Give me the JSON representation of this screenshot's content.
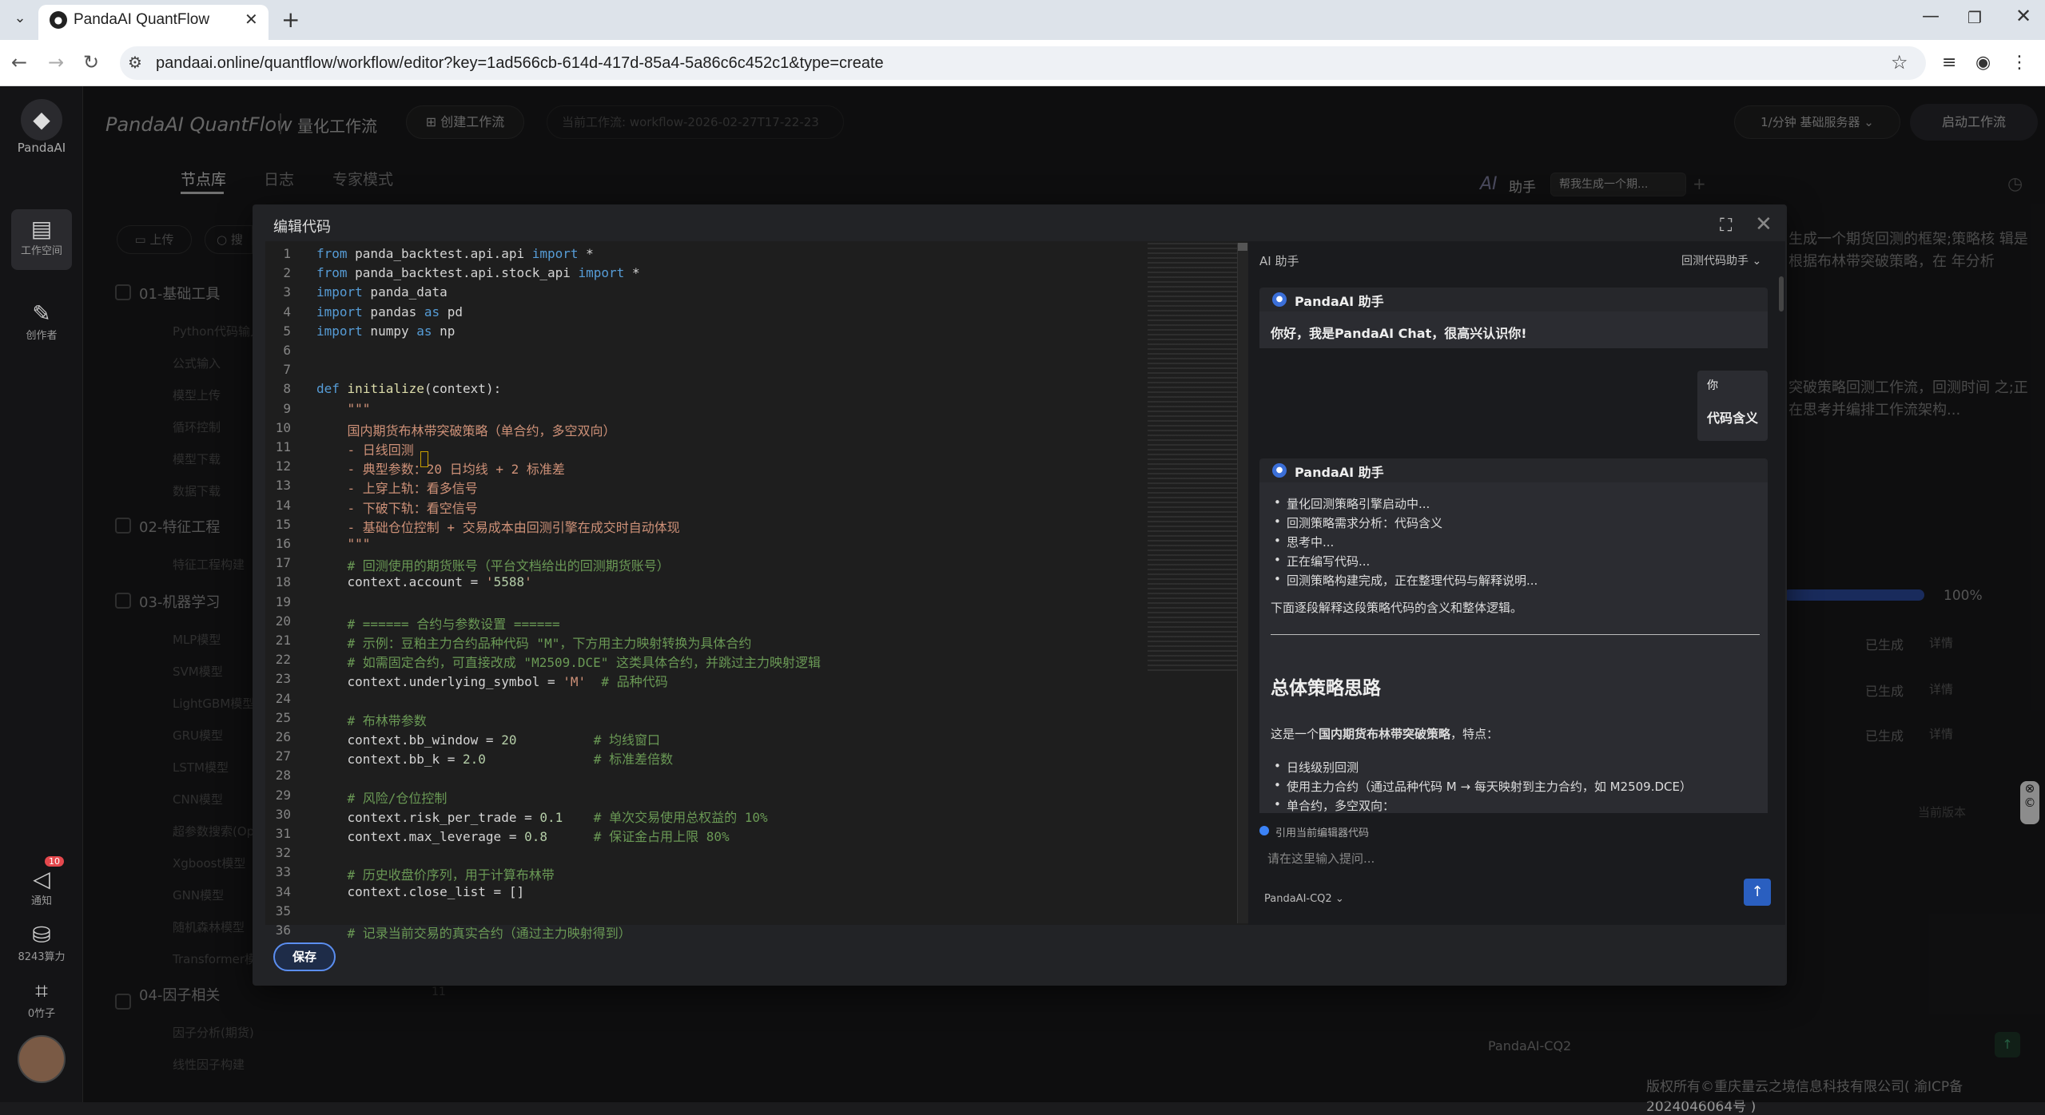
{
  "browser": {
    "tab_title": "PandaAI QuantFlow",
    "url": "pandaai.online/quantflow/workflow/editor?key=1ad566cb-614d-417d-85a4-5a86c6c452c1&type=create"
  },
  "sidebar": {
    "logo_text": "PandaAI",
    "items": [
      {
        "label": "工作空间",
        "icon": "layers-icon"
      },
      {
        "label": "创作者",
        "icon": "edit-icon"
      },
      {
        "label": "通知",
        "icon": "bell-icon",
        "badge": "10"
      },
      {
        "label": "8243算力",
        "icon": "database-icon"
      },
      {
        "label": "0竹子",
        "icon": "bamboo-icon"
      }
    ]
  },
  "header": {
    "title": "PandaAI QuantFlow",
    "subtitle": "量化工作流",
    "create_btn": "创建工作流",
    "current_workflow": "当前工作流:   workflow-2026-02-27T17-22-23",
    "rate": "1/分钟   基础服务器",
    "start_btn": "启动工作流"
  },
  "left_tabs": [
    "节点库",
    "日志",
    "专家模式"
  ],
  "left_panel": {
    "upload": "上传",
    "search": "搜",
    "categories": [
      {
        "name": "01-基础工具",
        "items": [
          "Python代码输入",
          "公式输入",
          "模型上传",
          "循环控制",
          "模型下载",
          "数据下载"
        ]
      },
      {
        "name": "02-特征工程",
        "items": [
          "特征工程构建"
        ]
      },
      {
        "name": "03-机器学习",
        "items": [
          "MLP模型",
          "SVM模型",
          "LightGBM模型",
          "GRU模型",
          "LSTM模型",
          "CNN模型",
          "超参数搜索(Op",
          "Xgboost模型",
          "GNN模型",
          "随机森林模型",
          "Transformer模型"
        ]
      },
      {
        "name": "04-因子相关",
        "items": [
          "因子分析(期货)",
          "线性因子构建"
        ]
      }
    ]
  },
  "bg_ai": {
    "title_ai": "AI",
    "title": "助手",
    "chip": "帮我生成一个期...",
    "text1": "生成一个期货回测的框架;策略核 辑是根据布林带突破策略，在 年分析",
    "text2": "突破策略回测工作流，回测时间 之;正在思考并编排工作流架构...",
    "progress": "100%",
    "progress_value": 1.0,
    "status": [
      "已生成",
      "已生成",
      "已生成"
    ],
    "detail": "详情",
    "current_version": "当前版本",
    "model": "PandaAI-CQ2"
  },
  "modal": {
    "title": "编辑代码",
    "save": "保存",
    "code_lines": [
      {
        "n": "1",
        "t": "from panda_backtest.api.api import *"
      },
      {
        "n": "2",
        "t": "from panda_backtest.api.stock_api import *"
      },
      {
        "n": "3",
        "t": "import panda_data"
      },
      {
        "n": "4",
        "t": "import pandas as pd"
      },
      {
        "n": "5",
        "t": "import numpy as np"
      },
      {
        "n": "6",
        "t": ""
      },
      {
        "n": "7",
        "t": ""
      },
      {
        "n": "8",
        "t": "def initialize(context):"
      },
      {
        "n": "9",
        "t": "    \"\"\""
      },
      {
        "n": "10",
        "t": "    国内期货布林带突破策略（单合约，多空双向）"
      },
      {
        "n": "11",
        "t": "    - 日线回测"
      },
      {
        "n": "12",
        "t": "    - 典型参数：20 日均线 + 2 标准差"
      },
      {
        "n": "13",
        "t": "    - 上穿上轨：看多信号"
      },
      {
        "n": "14",
        "t": "    - 下破下轨：看空信号"
      },
      {
        "n": "15",
        "t": "    - 基础仓位控制 + 交易成本由回测引擎在成交时自动体现"
      },
      {
        "n": "16",
        "t": "    \"\"\""
      },
      {
        "n": "17",
        "t": "    # 回测使用的期货账号（平台文档给出的回测期货账号）"
      },
      {
        "n": "18",
        "t": "    context.account = '5588'"
      },
      {
        "n": "19",
        "t": ""
      },
      {
        "n": "20",
        "t": "    # ====== 合约与参数设置 ======"
      },
      {
        "n": "21",
        "t": "    # 示例：豆粕主力合约品种代码 \"M\"，下方用主力映射转换为具体合约"
      },
      {
        "n": "22",
        "t": "    # 如需固定合约，可直接改成 \"M2509.DCE\" 这类具体合约，并跳过主力映射逻辑"
      },
      {
        "n": "23",
        "t": "    context.underlying_symbol = 'M'  # 品种代码"
      },
      {
        "n": "24",
        "t": ""
      },
      {
        "n": "25",
        "t": "    # 布林带参数"
      },
      {
        "n": "26",
        "t": "    context.bb_window = 20          # 均线窗口"
      },
      {
        "n": "27",
        "t": "    context.bb_k = 2.0              # 标准差倍数"
      },
      {
        "n": "28",
        "t": ""
      },
      {
        "n": "29",
        "t": "    # 风险/仓位控制"
      },
      {
        "n": "30",
        "t": "    context.risk_per_trade = 0.1    # 单次交易使用总权益的 10%"
      },
      {
        "n": "31",
        "t": "    context.max_leverage = 0.8      # 保证金占用上限 80%"
      },
      {
        "n": "32",
        "t": ""
      },
      {
        "n": "33",
        "t": "    # 历史收盘价序列，用于计算布林带"
      },
      {
        "n": "34",
        "t": "    context.close_list = []"
      },
      {
        "n": "35",
        "t": ""
      },
      {
        "n": "36",
        "t": "    # 记录当前交易的真实合约（通过主力映射得到）"
      }
    ]
  },
  "ai_chat": {
    "panel_label": "AI 助手",
    "mode": "回测代码助手",
    "assistant_name": "PandaAI 助手",
    "greeting": "你好，我是PandaAI Chat，很高兴认识你!",
    "user_label": "你",
    "user_msg": "代码含义",
    "steps": [
      "量化回测策略引擎启动中...",
      "回测策略需求分析：代码含义",
      "思考中...",
      "正在编写代码...",
      "回测策略构建完成，正在整理代码与解释说明..."
    ],
    "intro": "下面逐段解释这段策略代码的含义和整体逻辑。",
    "section_title": "总体策略思路",
    "section_desc_pre": "这是一个",
    "section_desc_bold": "国内期货布林带突破策略",
    "section_desc_post": "，特点：",
    "features": [
      "日线级别回测",
      "使用主力合约（通过品种代码 M → 每天映射到主力合约，如 M2509.DCE）",
      "单合约，多空双向："
    ],
    "ref_code": "引用当前编辑器代码",
    "placeholder": "请在这里输入提问...",
    "model": "PandaAI-CQ2"
  },
  "footer": "版权所有©重庆量云之境信息科技有限公司( 渝ICP备2024046064号 )",
  "bg_line_no": "11",
  "colors": {
    "accent": "#3b82f6",
    "save_border": "#5b8ef0",
    "badge": "#e5484d"
  }
}
